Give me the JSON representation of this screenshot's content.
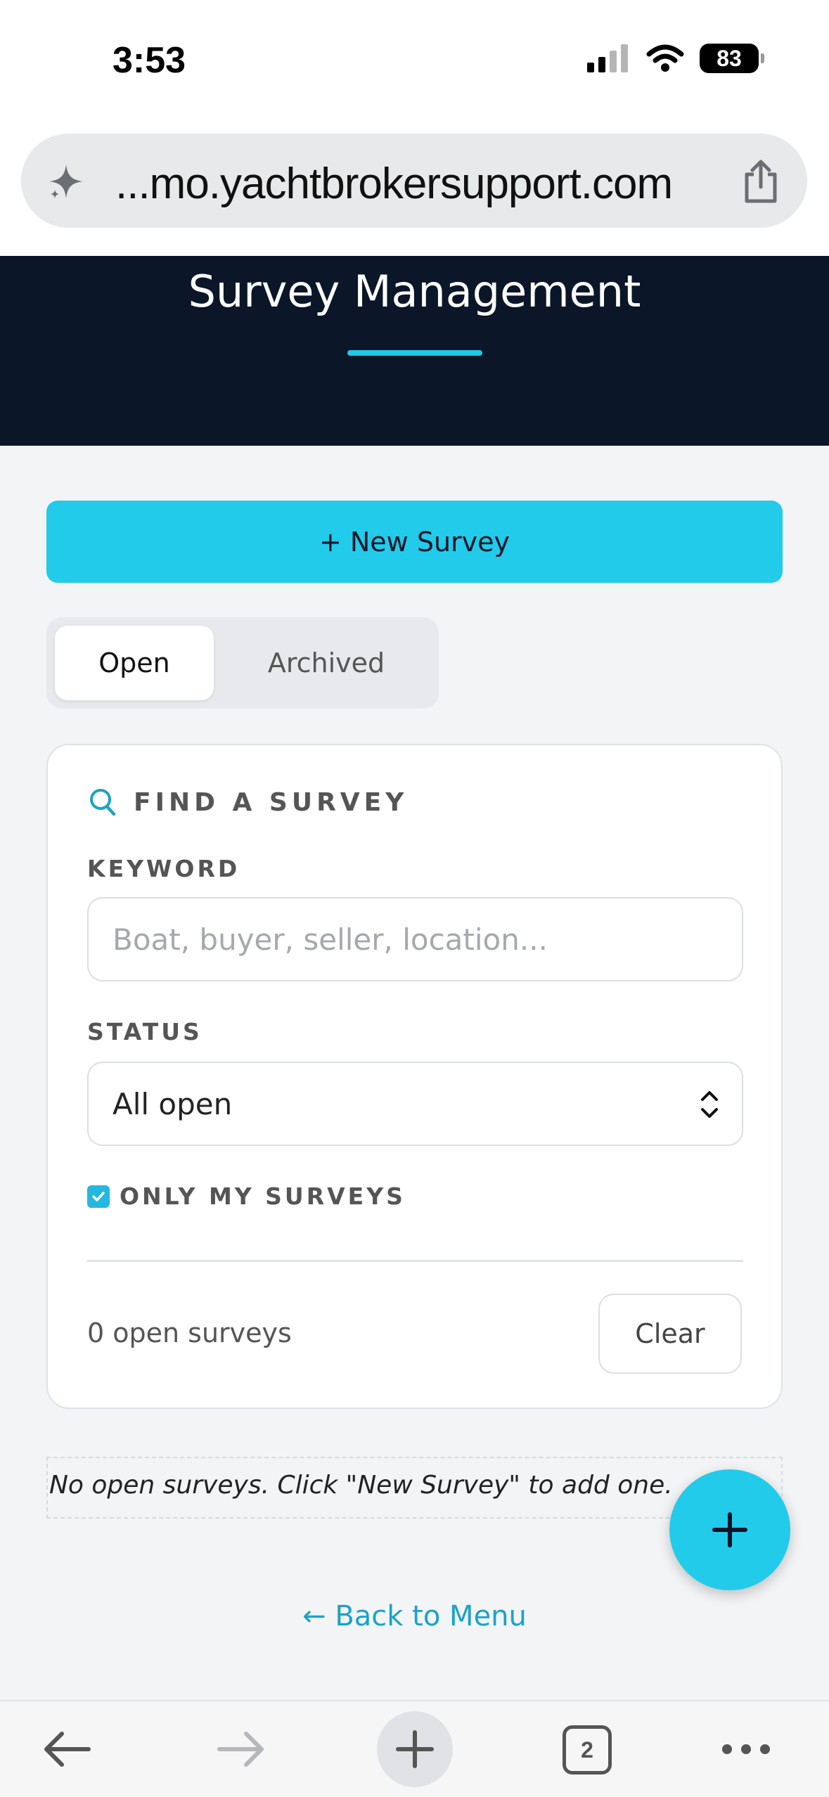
{
  "status_bar": {
    "time": "3:53",
    "battery": "83"
  },
  "browser": {
    "url": "...mo.yachtbrokersupport.com",
    "tab_count": "2"
  },
  "header": {
    "title": "Survey Management"
  },
  "actions": {
    "new_survey_label": "+ New Survey"
  },
  "tabs": [
    {
      "label": "Open",
      "active": true
    },
    {
      "label": "Archived",
      "active": false
    }
  ],
  "search": {
    "title": "FIND A SURVEY",
    "keyword_label": "KEYWORD",
    "keyword_placeholder": "Boat, buyer, seller, location...",
    "keyword_value": "",
    "status_label": "STATUS",
    "status_value": "All open",
    "only_mine_label": "ONLY MY SURVEYS",
    "only_mine_checked": true,
    "result_count": "0 open surveys",
    "clear_label": "Clear"
  },
  "empty_state": {
    "message": "No open surveys. Click \"New Survey\" to add one."
  },
  "footer": {
    "back_link": "← Back to Menu"
  },
  "colors": {
    "accent": "#22cbe9",
    "header_bg": "#0b1628",
    "link": "#1ba3c6"
  },
  "icons": {
    "url_left": "sparkle-icon",
    "url_right": "share-icon",
    "search": "search-icon",
    "fab": "plus-icon",
    "nav": [
      "back-arrow-icon",
      "forward-arrow-icon",
      "new-tab-icon",
      "tabs-icon",
      "more-icon"
    ]
  }
}
